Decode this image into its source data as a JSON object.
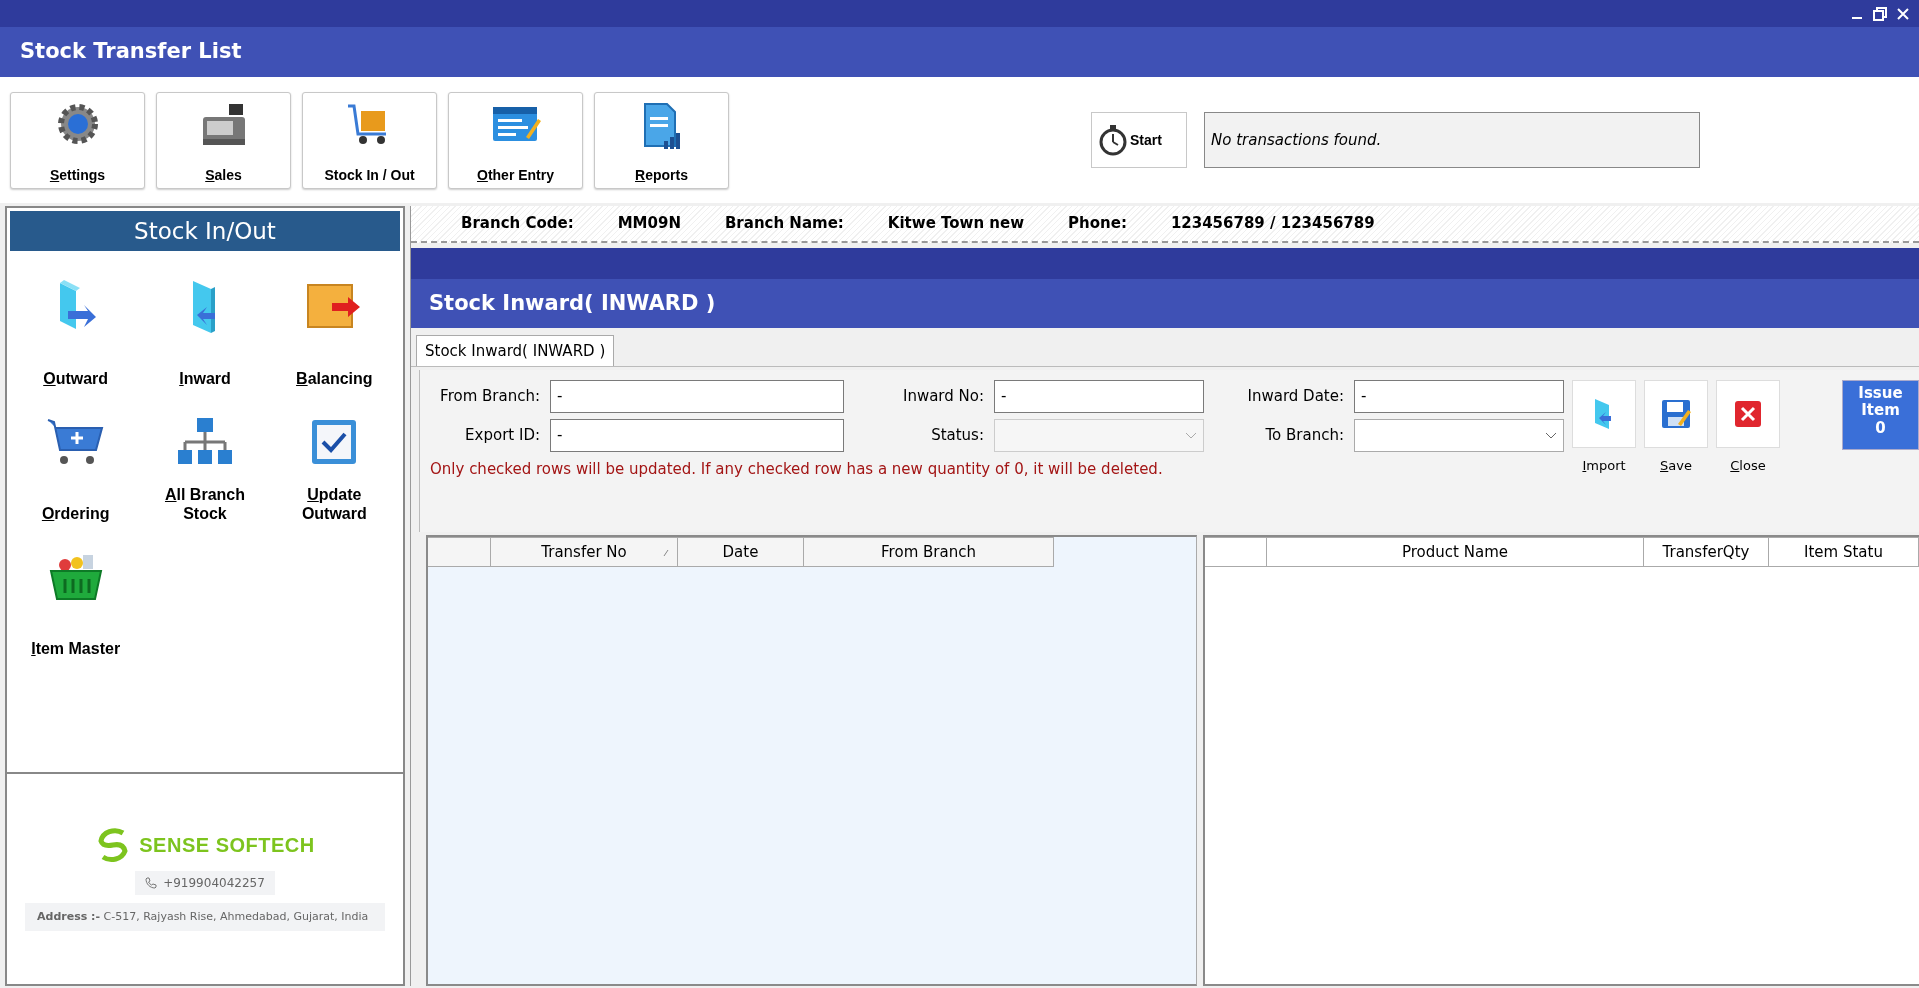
{
  "window": {
    "title": "Stock Transfer List"
  },
  "toolbar": [
    {
      "label": "Settings",
      "mnemonic": true
    },
    {
      "label": "Sales",
      "mnemonic": true
    },
    {
      "label": "Stock In / Out",
      "mnemonic": false
    },
    {
      "label": "Other Entry",
      "mnemonic": true
    },
    {
      "label": "Reports",
      "mnemonic": true
    }
  ],
  "status": {
    "start_label": "Start",
    "message": "No transactions found."
  },
  "sidebar": {
    "title": "Stock In/Out",
    "items": [
      {
        "label": "Outward",
        "mnemonic": true
      },
      {
        "label": "Inward",
        "mnemonic": true
      },
      {
        "label": "Balancing",
        "mnemonic": true
      },
      {
        "label": "Ordering",
        "mnemonic": true
      },
      {
        "label": "All Branch\nStock",
        "mnemonic": true
      },
      {
        "label": "Update\nOutward",
        "mnemonic": true
      },
      {
        "label": "Item Master",
        "mnemonic": true
      }
    ]
  },
  "company": {
    "name": "SENSE SOFTECH",
    "phone": "+919904042257",
    "address": "**Address :-** C-517, Rajyash Rise, Ahmedabad, Gujarat, India"
  },
  "branch_info": [
    {
      "label": "Branch Code:",
      "value": "MM09N"
    },
    {
      "label": "Branch Name:",
      "value": "Kitwe Town new"
    },
    {
      "label": "Phone:",
      "value": "123456789 / 123456789"
    }
  ],
  "form": {
    "title": "Stock Inward( INWARD )",
    "tabs": [
      {
        "label": "Stock Inward( INWARD )",
        "selected": true
      }
    ],
    "fields": [
      {
        "label": "From Branch:",
        "kind": "text",
        "value": "-"
      },
      {
        "label": "Inward No:",
        "kind": "text",
        "value": "-"
      },
      {
        "label": "Inward Date:",
        "kind": "text",
        "value": "-"
      },
      {
        "label": "Export ID:",
        "kind": "text",
        "value": "-"
      },
      {
        "label": "Status:",
        "kind": "select",
        "disabled": true
      },
      {
        "label": "To Branch:",
        "kind": "select",
        "disabled": false
      }
    ],
    "note": "Only checked rows will be updated. If any checked row has a new quantity of 0, it will be deleted.",
    "actions": [
      {
        "label": "Import",
        "mnemonic": true
      },
      {
        "label": "Save",
        "mnemonic": true
      },
      {
        "label": "Close",
        "mnemonic": true
      }
    ],
    "issue": {
      "label": "Issue Item",
      "count": "0"
    }
  },
  "transfers_table": {
    "columns": [
      {
        "label": "Transfer No",
        "sortable": true
      },
      {
        "label": "Date",
        "sortable": false
      },
      {
        "label": "From Branch",
        "sortable": false
      }
    ]
  },
  "items_table": {
    "columns": [
      {
        "label": "Product Name"
      },
      {
        "label": "TransferQty"
      },
      {
        "label": "Item Statu"
      }
    ]
  }
}
